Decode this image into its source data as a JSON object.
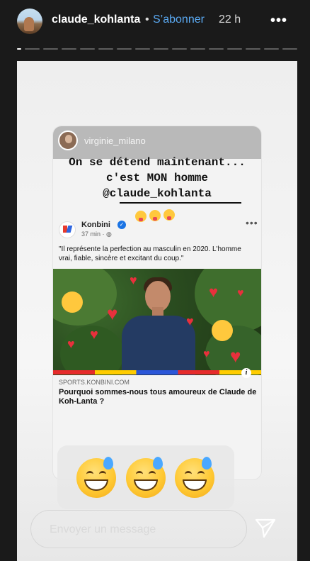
{
  "header": {
    "username": "claude_kohlanta",
    "separator": "•",
    "subscribe_label": "S’abonner",
    "time": "22 h",
    "more_label": "•••"
  },
  "progress": {
    "segments": 16,
    "active_index": 0
  },
  "story": {
    "repost_user": "virginie_milano",
    "caption": "On se détend maintenant... c'est MON homme @claude_kohlanta",
    "post": {
      "page_name": "Konbini",
      "meta": "37 min · ",
      "quote": "\"Il représente la perfection au masculin en 2020. L'homme vrai, fiable, sincère et excitant du coup.\"",
      "link_source": "SPORTS.KONBINI.COM",
      "link_title": "Pourquoi sommes-nous tous amoureux de Claude de Koh-Lanta ?"
    },
    "reaction_emojis": [
      "grinning-sweat-emoji",
      "grinning-sweat-emoji",
      "grinning-sweat-emoji"
    ]
  },
  "composer": {
    "placeholder": "Envoyer un message",
    "send_icon": "paper-plane-icon"
  },
  "colors": {
    "subscribe": "#5aa9f2",
    "background": "#1a1a1a",
    "heart": "#e8303c"
  }
}
